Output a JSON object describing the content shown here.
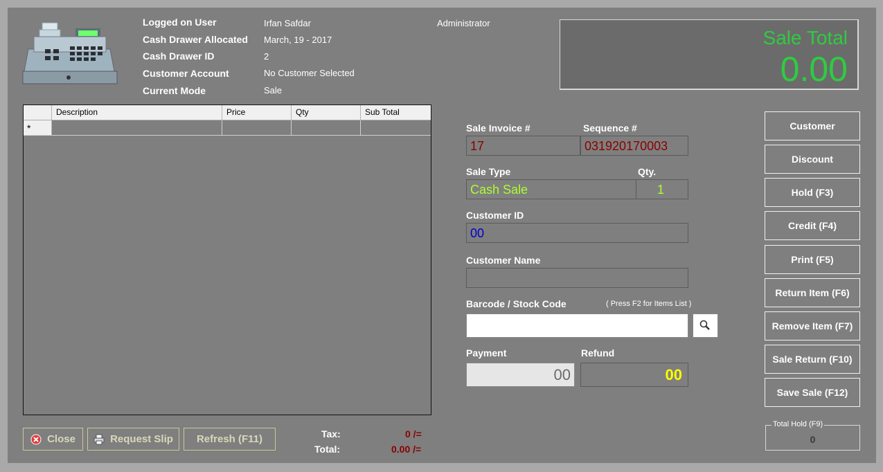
{
  "header": {
    "labels": [
      "Logged on User",
      "Cash Drawer Allocated",
      "Cash Drawer ID",
      "Customer Account",
      "Current Mode"
    ],
    "values": [
      "Irfan Safdar",
      "March, 19 - 2017",
      "2",
      "No Customer Selected",
      "Sale"
    ],
    "role": "Administrator"
  },
  "sale_total": {
    "label": "Sale Total",
    "value": "0.00"
  },
  "grid": {
    "columns": [
      "Description",
      "Price",
      "Qty",
      "Sub Total"
    ],
    "new_row_marker": "*"
  },
  "form": {
    "sale_invoice_label": "Sale Invoice #",
    "sale_invoice_value": "17",
    "sequence_label": "Sequence #",
    "sequence_value": "031920170003",
    "sale_type_label": "Sale Type",
    "sale_type_value": "Cash Sale",
    "qty_label": "Qty.",
    "qty_value": "1",
    "customer_id_label": "Customer ID",
    "customer_id_value": "00",
    "customer_name_label": "Customer Name",
    "customer_name_value": "",
    "barcode_label": "Barcode / Stock Code",
    "barcode_hint": "( Press F2 for Items List )",
    "barcode_value": "",
    "payment_label": "Payment",
    "payment_value": "00",
    "refund_label": "Refund",
    "refund_value": "00"
  },
  "actions": [
    "Customer",
    "Discount",
    "Hold (F3)",
    "Credit (F4)",
    "Print (F5)",
    "Return Item (F6)",
    "Remove Item (F7)",
    "Sale Return (F10)",
    "Save Sale (F12)"
  ],
  "bottom": {
    "close": "Close",
    "request_slip": "Request Slip",
    "refresh": "Refresh (F11)",
    "tax_label": "Tax:",
    "tax_value": "0 /=",
    "total_label": "Total:",
    "total_value": "0.00 /="
  },
  "total_hold": {
    "label": "Total Hold (F9)",
    "value": "0"
  },
  "colors": {
    "panel": "#7f7f7f",
    "sale_total_green": "#2ecc40",
    "invoice_red": "#8b0000",
    "sale_type_green": "#adff2f",
    "customer_id_blue": "#0000cd",
    "refund_yellow": "#ffff00"
  }
}
